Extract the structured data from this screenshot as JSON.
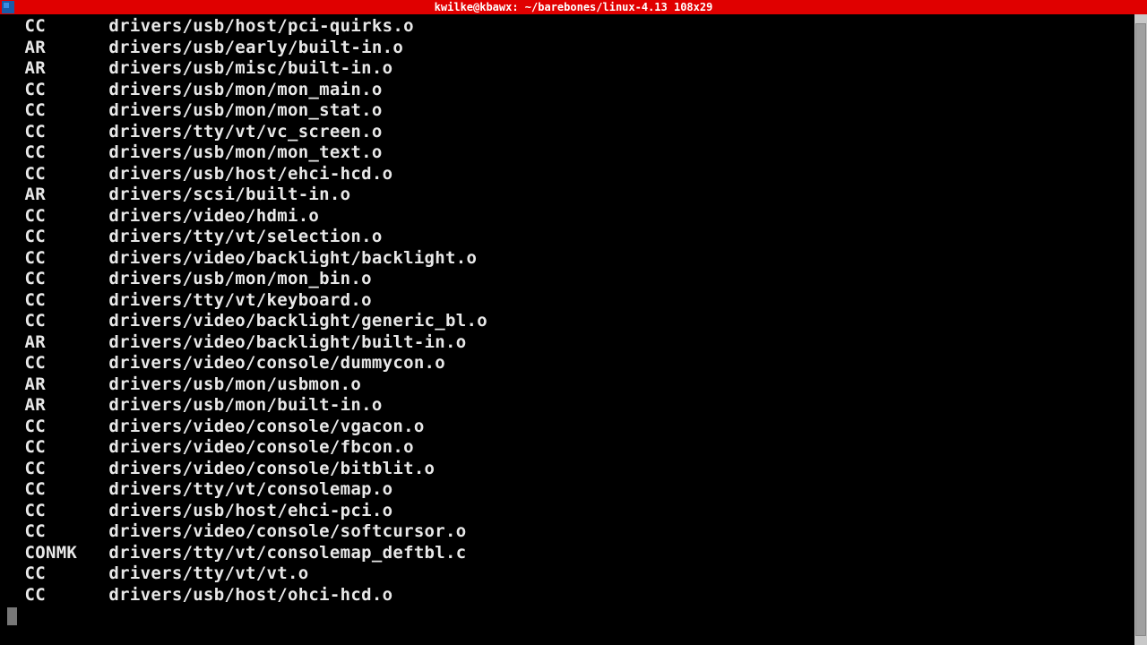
{
  "window": {
    "title": "kwilke@kbawx: ~/barebones/linux-4.13 108x29"
  },
  "lines": [
    {
      "tag": "CC",
      "path": "drivers/usb/host/pci-quirks.o"
    },
    {
      "tag": "AR",
      "path": "drivers/usb/early/built-in.o"
    },
    {
      "tag": "AR",
      "path": "drivers/usb/misc/built-in.o"
    },
    {
      "tag": "CC",
      "path": "drivers/usb/mon/mon_main.o"
    },
    {
      "tag": "CC",
      "path": "drivers/usb/mon/mon_stat.o"
    },
    {
      "tag": "CC",
      "path": "drivers/tty/vt/vc_screen.o"
    },
    {
      "tag": "CC",
      "path": "drivers/usb/mon/mon_text.o"
    },
    {
      "tag": "CC",
      "path": "drivers/usb/host/ehci-hcd.o"
    },
    {
      "tag": "AR",
      "path": "drivers/scsi/built-in.o"
    },
    {
      "tag": "CC",
      "path": "drivers/video/hdmi.o"
    },
    {
      "tag": "CC",
      "path": "drivers/tty/vt/selection.o"
    },
    {
      "tag": "CC",
      "path": "drivers/video/backlight/backlight.o"
    },
    {
      "tag": "CC",
      "path": "drivers/usb/mon/mon_bin.o"
    },
    {
      "tag": "CC",
      "path": "drivers/tty/vt/keyboard.o"
    },
    {
      "tag": "CC",
      "path": "drivers/video/backlight/generic_bl.o"
    },
    {
      "tag": "AR",
      "path": "drivers/video/backlight/built-in.o"
    },
    {
      "tag": "CC",
      "path": "drivers/video/console/dummycon.o"
    },
    {
      "tag": "AR",
      "path": "drivers/usb/mon/usbmon.o"
    },
    {
      "tag": "AR",
      "path": "drivers/usb/mon/built-in.o"
    },
    {
      "tag": "CC",
      "path": "drivers/video/console/vgacon.o"
    },
    {
      "tag": "CC",
      "path": "drivers/video/console/fbcon.o"
    },
    {
      "tag": "CC",
      "path": "drivers/video/console/bitblit.o"
    },
    {
      "tag": "CC",
      "path": "drivers/tty/vt/consolemap.o"
    },
    {
      "tag": "CC",
      "path": "drivers/usb/host/ehci-pci.o"
    },
    {
      "tag": "CC",
      "path": "drivers/video/console/softcursor.o"
    },
    {
      "tag": "CONMK",
      "path": "drivers/tty/vt/consolemap_deftbl.c"
    },
    {
      "tag": "CC",
      "path": "drivers/tty/vt/vt.o"
    },
    {
      "tag": "CC",
      "path": "drivers/usb/host/ohci-hcd.o"
    }
  ]
}
